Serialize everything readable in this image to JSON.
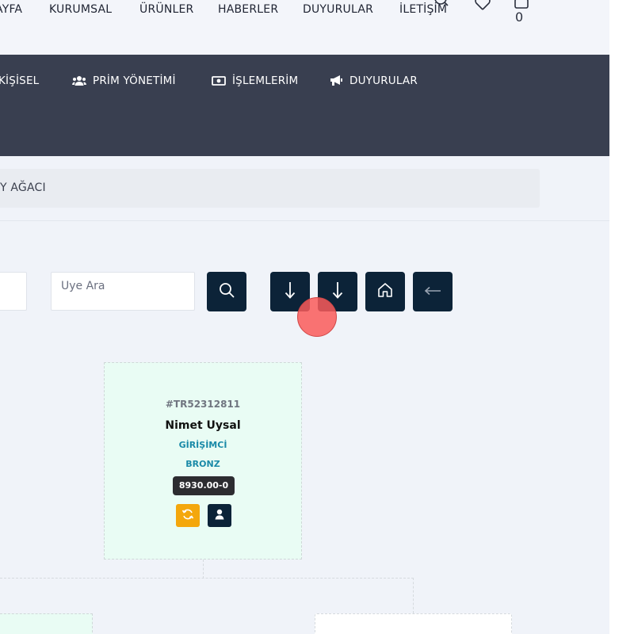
{
  "topnav": {
    "links": [
      "AYFA",
      "KURUMSAL",
      "ÜRÜNLER",
      "HABERLER",
      "DUYURULAR",
      "İLETİŞİM"
    ],
    "cart_count": "0",
    "icons": [
      "search-icon",
      "heart-icon",
      "cart-icon"
    ]
  },
  "menu": {
    "items": [
      {
        "label": "KİŞİSEL",
        "icon": "user-icon"
      },
      {
        "label": "PRİM YÖNETİMİ",
        "icon": "users-icon"
      },
      {
        "label": "İŞLEMLERİM",
        "icon": "money-icon"
      },
      {
        "label": "DUYURULAR",
        "icon": "bullhorn-icon"
      }
    ]
  },
  "breadcrumb": {
    "text": "Y AĞACI"
  },
  "search": {
    "placeholder": "Üye Ara",
    "buttons": [
      "search-icon",
      "arrow-down-icon",
      "arrow-down-icon",
      "home-icon",
      "arrow-left-icon"
    ]
  },
  "card": {
    "code": "#TR52312811",
    "name": "Nimet Uysal",
    "rank": "GİRİŞİMCİ",
    "level": "BRONZ",
    "points": "8930.00-0",
    "button_colors": {
      "refresh": "#f4a70c",
      "profile": "#0c2338"
    }
  },
  "colors": {
    "menu_bar": "#393f50",
    "button": "#0c2338",
    "card_bg": "#e9fcf4",
    "accent_text": "#1a8aa8"
  }
}
